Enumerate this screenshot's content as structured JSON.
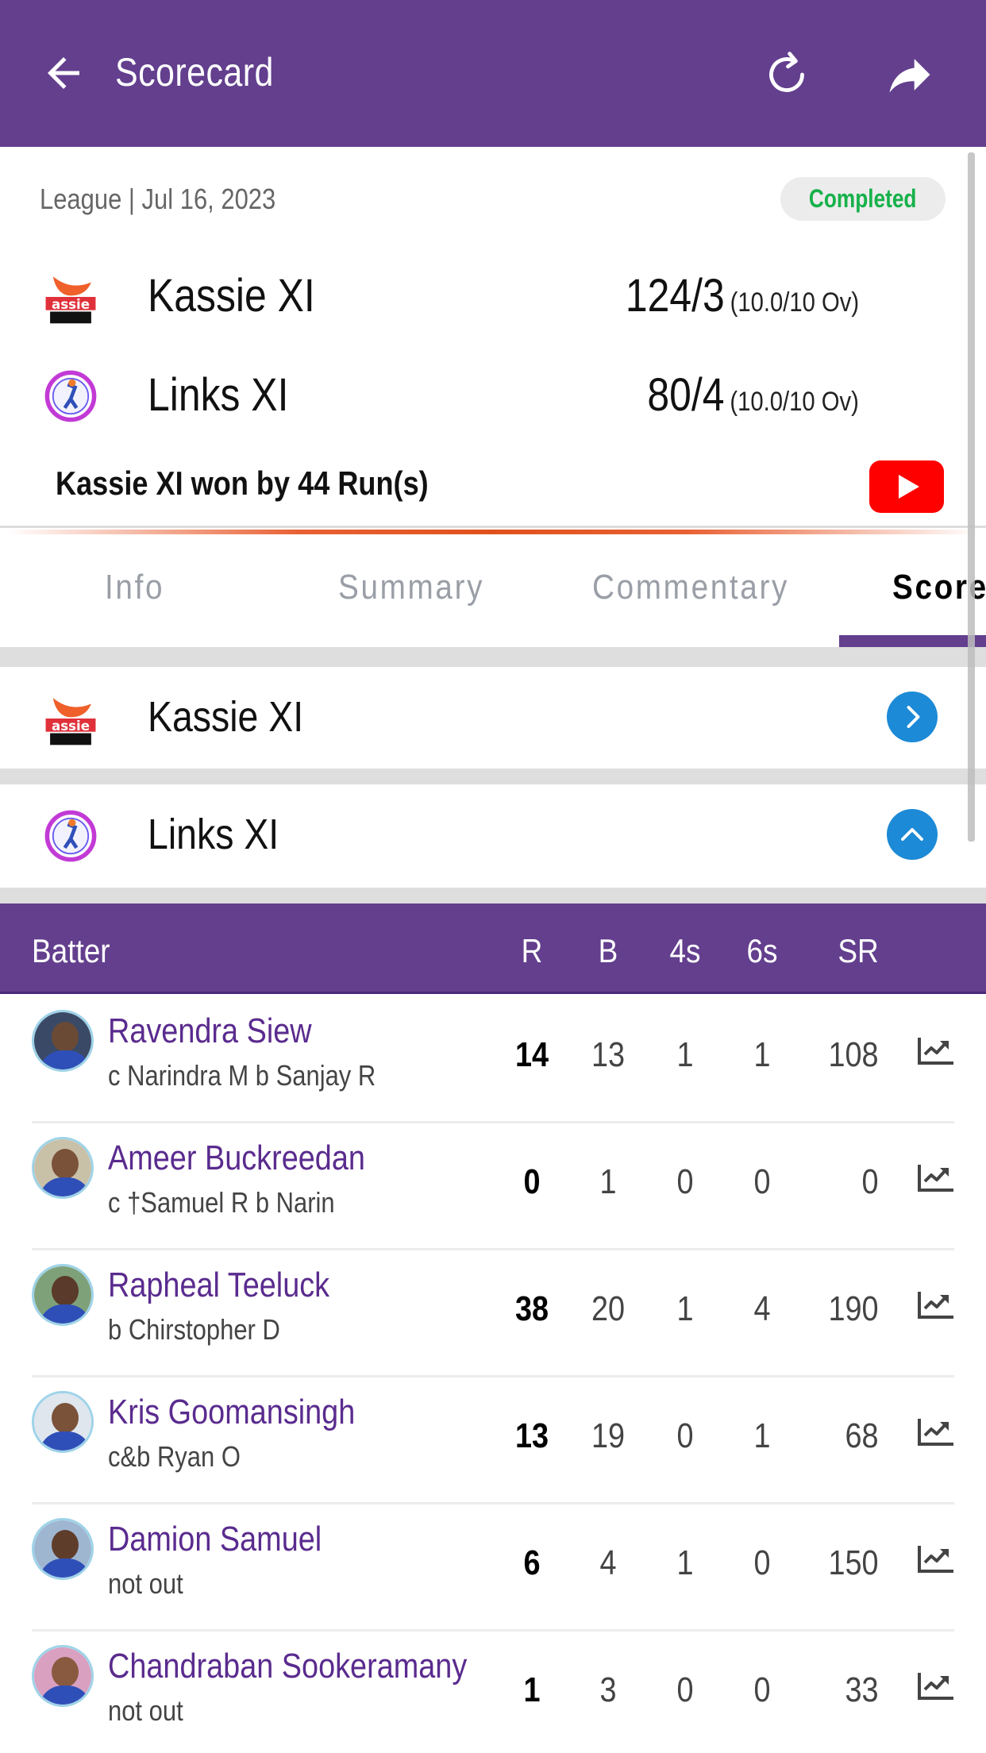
{
  "appbar": {
    "title": "Scorecard",
    "icons": [
      "back-arrow-icon",
      "refresh-icon",
      "share-icon"
    ],
    "background": "#633f8e"
  },
  "match": {
    "meta": "League | Jul 16, 2023",
    "status": "Completed",
    "status_color": "#16b14a",
    "teams": [
      {
        "name": "Kassie XI",
        "score": "124/3",
        "overs": "(10.0/10 Ov)",
        "logo": "kassie-xi-logo"
      },
      {
        "name": "Links XI",
        "score": "80/4",
        "overs": "(10.0/10 Ov)",
        "logo": "links-xi-logo"
      }
    ],
    "result": "Kassie XI won by 44 Run(s)",
    "video_icon": "youtube-icon"
  },
  "tabs": [
    {
      "label": "Info",
      "active": false
    },
    {
      "label": "Summary",
      "active": false
    },
    {
      "label": "Commentary",
      "active": false
    },
    {
      "label": "Score",
      "active": true
    }
  ],
  "innings": [
    {
      "team": "Kassie XI",
      "expanded": false,
      "toggle_icon": "chevron-right-icon"
    },
    {
      "team": "Links XI",
      "expanded": true,
      "toggle_icon": "chevron-up-icon"
    }
  ],
  "batting": {
    "headers": {
      "batter": "Batter",
      "r": "R",
      "b": "B",
      "fours": "4s",
      "sixes": "6s",
      "sr": "SR"
    },
    "rows": [
      {
        "name": "Ravendra Siew",
        "dismissal": "c Narindra M b Sanjay R",
        "r": "14",
        "b": "13",
        "fours": "1",
        "sixes": "1",
        "sr": "108"
      },
      {
        "name": "Ameer Buckreedan",
        "dismissal": "c †Samuel R b Narin",
        "r": "0",
        "b": "1",
        "fours": "0",
        "sixes": "0",
        "sr": "0"
      },
      {
        "name": "Rapheal Teeluck",
        "dismissal": "b Chirstopher D",
        "r": "38",
        "b": "20",
        "fours": "1",
        "sixes": "4",
        "sr": "190"
      },
      {
        "name": "Kris Goomansingh",
        "dismissal": "c&b Ryan O",
        "r": "13",
        "b": "19",
        "fours": "0",
        "sixes": "1",
        "sr": "68"
      },
      {
        "name": "Damion Samuel",
        "dismissal": "not out",
        "r": "6",
        "b": "4",
        "fours": "1",
        "sixes": "0",
        "sr": "150"
      },
      {
        "name": "Chandraban Sookeramany",
        "dismissal": "not out",
        "r": "1",
        "b": "3",
        "fours": "0",
        "sixes": "0",
        "sr": "33"
      }
    ],
    "row_icon": "trending-up-chart-icon"
  },
  "colors": {
    "primary": "#633f8e",
    "player_name": "#5a2b8e",
    "chevron_button": "#1c8ad6",
    "youtube": "#ff0000",
    "divider_accent": "#e0521d"
  }
}
